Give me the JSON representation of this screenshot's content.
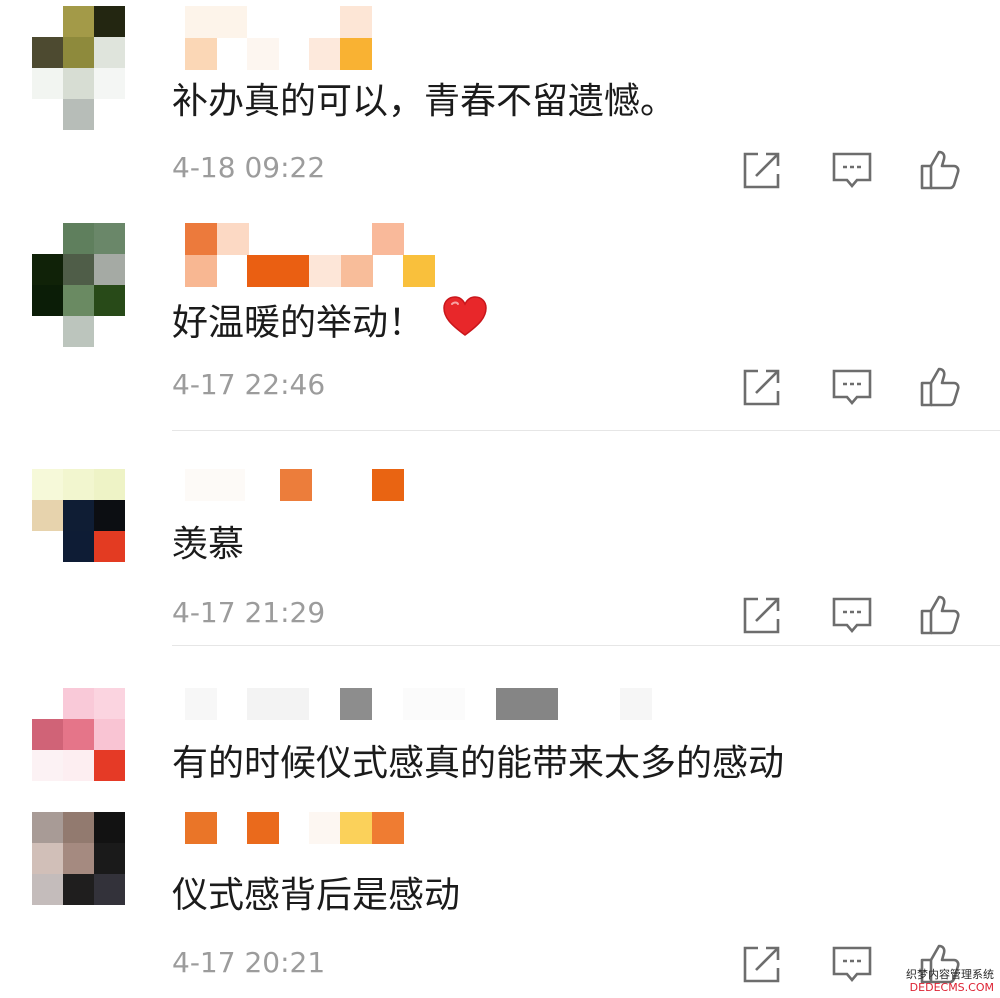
{
  "comments": [
    {
      "text": "补办真的可以，青春不留遗憾。",
      "time": "4-18 09:22",
      "emoji": ""
    },
    {
      "text": "好温暖的举动！",
      "time": "4-17 22:46",
      "emoji": "red-heart"
    },
    {
      "text": "羡慕",
      "time": "4-17 21:29",
      "emoji": ""
    },
    {
      "text": "有的时候仪式感真的能带来太多的感动",
      "time": "",
      "emoji": ""
    },
    {
      "text": "仪式感背后是感动",
      "time": "4-17 20:21",
      "emoji": ""
    }
  ],
  "actions": {
    "share_icon": "share-icon",
    "reply_icon": "comment-icon",
    "like_icon": "thumbs-up-icon"
  },
  "colors": {
    "text": "#1b1b1b",
    "time": "#9c9c9c",
    "icon": "#6d6d6d",
    "heart": "#e8272a",
    "divider": "#e6e6e6"
  },
  "watermark": {
    "line1": "织梦内容管理系统",
    "line2": "DEDECMS.COM"
  }
}
